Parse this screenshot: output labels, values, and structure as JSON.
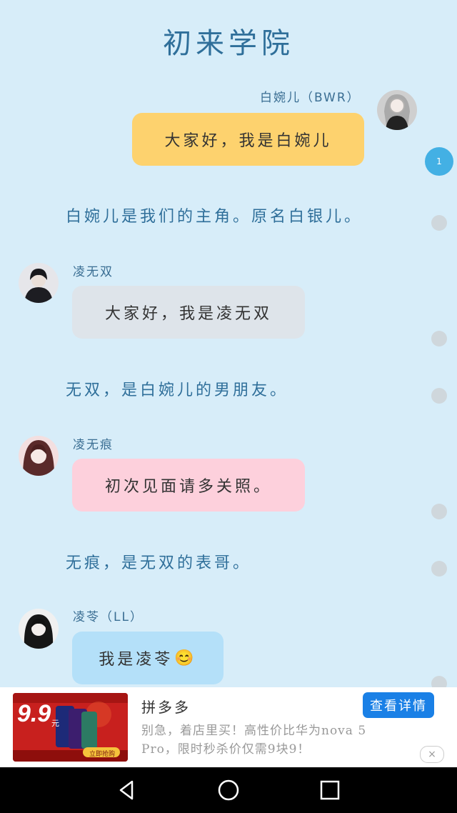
{
  "app": {
    "title": "初来学院"
  },
  "chat": [
    {
      "speaker": "白婉儿（BWR）",
      "text": "大家好，我是白婉儿"
    },
    {
      "narration": "白婉儿是我们的主角。原名白银儿。"
    },
    {
      "speaker": "凌无双",
      "text": "大家好，我是凌无双"
    },
    {
      "narration": "无双，是白婉儿的男朋友。"
    },
    {
      "speaker": "凌无痕",
      "text": "初次见面请多关照。"
    },
    {
      "narration": "无痕，是无双的表哥。"
    },
    {
      "speaker": "凌苓（LL）",
      "text": "我是凌苓",
      "emoji": "😊"
    }
  ],
  "progress": {
    "current_label": "1"
  },
  "ad": {
    "app_name": "拼多多",
    "description": "别急，着店里买！高性价比华为nova 5 Pro，限时秒杀价仅需9块9！",
    "button_label": "查看详情",
    "close_icon": "×",
    "image": {
      "price": "9.9",
      "unit": "元",
      "cta": "立即抢购"
    }
  },
  "colors": {
    "background": "#d7edf9",
    "accent": "#43b0e4",
    "bubble_yellow": "#fdd26e",
    "bubble_gray": "#dee4ea",
    "bubble_pink": "#fdd0dc",
    "bubble_blue": "#b4e0f9"
  },
  "navbar": {
    "icons": [
      "back-icon",
      "home-icon",
      "recents-icon"
    ]
  }
}
